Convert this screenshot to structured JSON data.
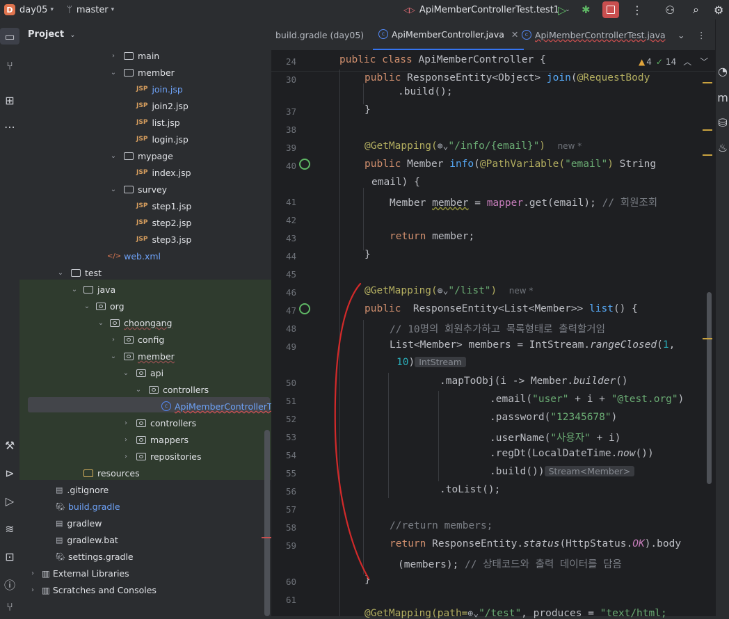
{
  "titlebar": {
    "project_badge": "D",
    "project_name": "day05",
    "branch": "master",
    "run_config": "ApiMemberControllerTest.test1",
    "icons": [
      "branch-icon",
      "run-icon",
      "debug-icon",
      "stop-icon",
      "more-icon",
      "add-user-icon",
      "search-icon",
      "settings-icon"
    ]
  },
  "project_panel": {
    "title": "Project",
    "tree": [
      {
        "label": "main",
        "type": "folder",
        "indent": 0,
        "arrow": "›"
      },
      {
        "label": "member",
        "type": "folder",
        "indent": 0,
        "arrow": "⌄"
      },
      {
        "label": "join.jsp",
        "type": "jsp",
        "indent": 1,
        "arrow": "",
        "selected_text": true
      },
      {
        "label": "join2.jsp",
        "type": "jsp",
        "indent": 1,
        "arrow": ""
      },
      {
        "label": "list.jsp",
        "type": "jsp",
        "indent": 1,
        "arrow": ""
      },
      {
        "label": "login.jsp",
        "type": "jsp",
        "indent": 1,
        "arrow": ""
      },
      {
        "label": "mypage",
        "type": "folder",
        "indent": 0,
        "arrow": "⌄"
      },
      {
        "label": "index.jsp",
        "type": "jsp",
        "indent": 1,
        "arrow": ""
      },
      {
        "label": "survey",
        "type": "folder",
        "indent": 0,
        "arrow": "⌄"
      },
      {
        "label": "step1.jsp",
        "type": "jsp",
        "indent": 1,
        "arrow": ""
      },
      {
        "label": "step2.jsp",
        "type": "jsp",
        "indent": 1,
        "arrow": ""
      },
      {
        "label": "step3.jsp",
        "type": "jsp",
        "indent": 1,
        "arrow": ""
      },
      {
        "label": "web.xml",
        "type": "xml",
        "indent": 0,
        "arrow": ""
      },
      {
        "label": "test",
        "type": "folder",
        "indent": 0,
        "arrow": "⌄"
      },
      {
        "label": "java",
        "type": "folder",
        "indent": 1,
        "arrow": "⌄"
      },
      {
        "label": "org",
        "type": "pkg",
        "indent": 2,
        "arrow": "⌄"
      },
      {
        "label": "choongang",
        "type": "pkg",
        "indent": 3,
        "arrow": "⌄"
      },
      {
        "label": "config",
        "type": "pkg",
        "indent": 4,
        "arrow": "›"
      },
      {
        "label": "member",
        "type": "pkg",
        "indent": 4,
        "arrow": "⌄"
      },
      {
        "label": "api",
        "type": "pkg",
        "indent": 5,
        "arrow": "⌄"
      },
      {
        "label": "controllers",
        "type": "pkg",
        "indent": 6,
        "arrow": "⌄"
      },
      {
        "label": "ApiMemberControllerTest",
        "type": "class",
        "indent": 7,
        "arrow": ""
      },
      {
        "label": "controllers",
        "type": "pkg",
        "indent": 5,
        "arrow": "›"
      },
      {
        "label": "mappers",
        "type": "pkg",
        "indent": 5,
        "arrow": "›"
      },
      {
        "label": "repositories",
        "type": "pkg",
        "indent": 5,
        "arrow": "›"
      },
      {
        "label": "resources",
        "type": "res",
        "indent": 2,
        "arrow": ""
      },
      {
        "label": ".gitignore",
        "type": "file",
        "indent": 0,
        "arrow": ""
      },
      {
        "label": "build.gradle",
        "type": "gradle",
        "indent": 0,
        "arrow": ""
      },
      {
        "label": "gradlew",
        "type": "file",
        "indent": 0,
        "arrow": ""
      },
      {
        "label": "gradlew.bat",
        "type": "file",
        "indent": 0,
        "arrow": ""
      },
      {
        "label": "settings.gradle",
        "type": "gradle",
        "indent": 0,
        "arrow": ""
      },
      {
        "label": "External Libraries",
        "type": "lib",
        "indent": 0,
        "arrow": "›"
      },
      {
        "label": "Scratches and Consoles",
        "type": "lib",
        "indent": 0,
        "arrow": "›"
      }
    ]
  },
  "editor": {
    "tabs": [
      {
        "label": "build.gradle (day05)",
        "active": false
      },
      {
        "label": "ApiMemberController.java",
        "active": true
      },
      {
        "label": "ApiMemberControllerTest.java",
        "active": false
      }
    ],
    "inspections": {
      "warnings": "4",
      "ok": "14"
    },
    "hints": {
      "new1": "new *",
      "new2": "new *",
      "int_stream": "IntStream",
      "stream_member": "Stream<Member>"
    },
    "line_numbers": [
      "24",
      "30",
      "37",
      "38",
      "39",
      "40",
      "41",
      "42",
      "43",
      "44",
      "45",
      "46",
      "47",
      "48",
      "49",
      "50",
      "51",
      "52",
      "53",
      "54",
      "55",
      "56",
      "57",
      "58",
      "59",
      "60",
      "61"
    ],
    "lines": {
      "l24": "public class ApiMemberController {",
      "l30a": "public ResponseEntity<Object> join(@RequestBody",
      "l30b": ".build();",
      "l37": "}",
      "l39": "@GetMapping(",
      "l39s": "\"/info/{email}\"",
      "l40a": "public Member info(@PathVariable(",
      "l40s": "\"email\"",
      "l40b": ") String",
      "l40c": "email) {",
      "l41a": "Member member = mapper.get(email);",
      "l41c": "// 회원조회",
      "l43": "return member;",
      "l44": "}",
      "l46s": "\"/list\"",
      "l47": "public  ResponseEntity<List<Member>> list() {",
      "l48": "// 10명의 회원추가하고 목록형태로 출력할거임",
      "l49": "List<Member> members = IntStream.rangeClosed(1,",
      "l49b": "10)",
      "l50": ".mapToObj(i -> Member.builder()",
      "l51": ".email(\"user\" + i + \"@test.org\")",
      "l52": ".password(\"12345678\")",
      "l53": ".userName(\"사용자\" + i)",
      "l54": ".regDt(LocalDateTime.now())",
      "l55": ".build())",
      "l56": ".toList();",
      "l58": "//return members;",
      "l59": "return ResponseEntity.status(HttpStatus.OK).body",
      "l59b": "(members); // 상태코드와 출력 데이터를 담음",
      "l60": "}",
      "l62": "@GetMapping(path=",
      "l62b": "\"/test\", produces = \"text/html;"
    }
  }
}
